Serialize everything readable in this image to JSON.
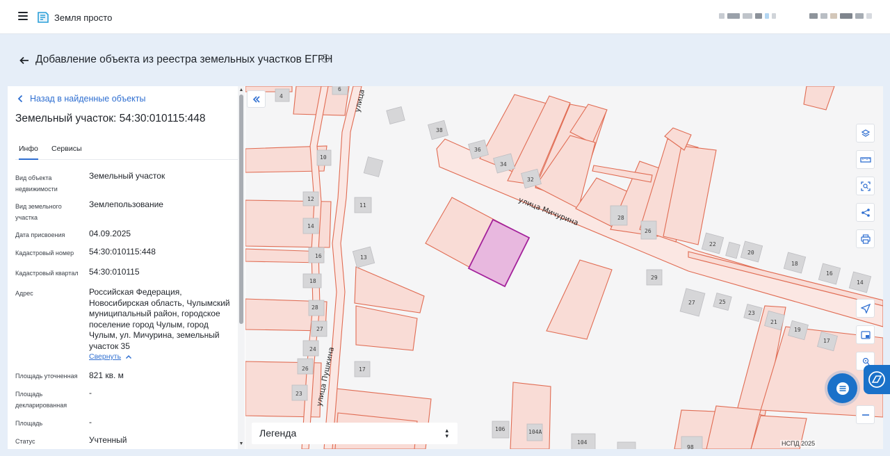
{
  "app": {
    "brand_name": "Земля просто"
  },
  "header": {
    "page_title": "Добавление объекта из реестра земельных участков ЕГРН"
  },
  "panel": {
    "back_link": "Назад в найденные объекты",
    "title": "Земельный участок: 54:30:010115:448",
    "tabs": [
      {
        "label": "Инфо",
        "active": true
      },
      {
        "label": "Сервисы",
        "active": false
      }
    ],
    "rows": [
      {
        "label": "Вид объекта недвижимости",
        "value": "Земельный участок"
      },
      {
        "label": "Вид земельного участка",
        "value": "Землепользование"
      },
      {
        "label": "Дата присвоения",
        "value": "04.09.2025"
      },
      {
        "label": "Кадастровый номер",
        "value": "54:30:010115:448"
      },
      {
        "label": "Кадастровый квартал",
        "value": "54:30:010115"
      },
      {
        "label": "Адрес",
        "value": "Российская Федерация, Новосибирская область, Чулымский муниципальный район, городское поселение город Чулым, город Чулым, ул. Мичурина, земельный участок 35"
      },
      {
        "label": "Площадь уточненная",
        "value": "821 кв. м"
      },
      {
        "label": "Площадь декларированная",
        "value": "-"
      },
      {
        "label": "Площадь",
        "value": "-"
      },
      {
        "label": "Статус",
        "value": "Учтенный"
      }
    ],
    "collapse_label": "Свернуть"
  },
  "map": {
    "legend_label": "Легенда",
    "attribution": "НСПД 2025",
    "streets": [
      "улица Мичурина",
      "улица Пушкина",
      "улица"
    ],
    "house_numbers": [
      "4",
      "6",
      "38",
      "36",
      "34",
      "32",
      "10",
      "12",
      "11",
      "14",
      "16",
      "13",
      "18",
      "28",
      "27",
      "24",
      "26",
      "25",
      "17",
      "22",
      "20",
      "18",
      "16",
      "14",
      "29",
      "27",
      "25",
      "23",
      "21",
      "19",
      "17",
      "28",
      "26",
      "106",
      "104А",
      "104",
      "98"
    ],
    "selected_color": "#e8b8df",
    "parcel_color": "#f9dcd6",
    "parcel_stroke": "#e06b52",
    "tools": [
      "layers-icon",
      "ruler-icon",
      "select-area-icon",
      "share-icon",
      "print-icon",
      "locate-icon",
      "minimap-icon",
      "place-icon",
      "zoom-out-icon"
    ]
  }
}
